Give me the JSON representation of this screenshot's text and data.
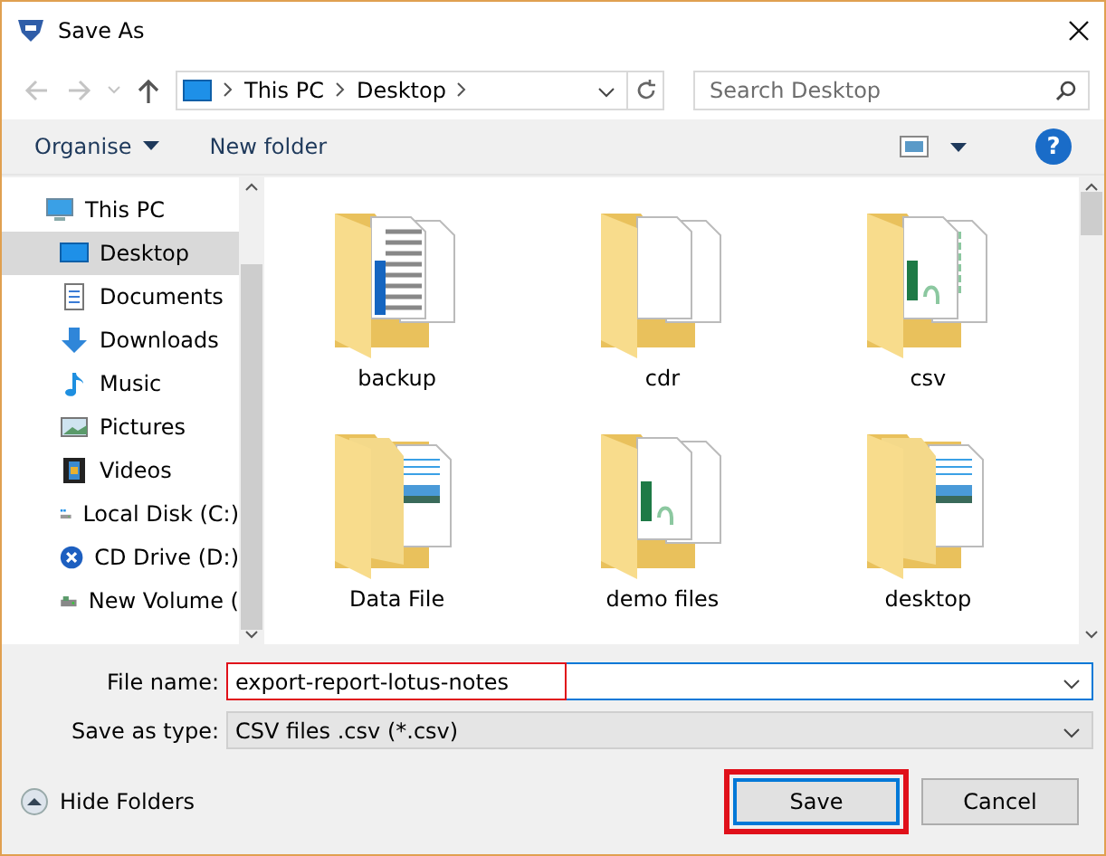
{
  "window": {
    "title": "Save As"
  },
  "address": {
    "path": [
      "This PC",
      "Desktop"
    ],
    "search_placeholder": "Search Desktop"
  },
  "toolbar": {
    "organise": "Organise",
    "new_folder": "New folder",
    "help": "?"
  },
  "sidebar": {
    "items": [
      {
        "label": "This PC",
        "kind": "pc",
        "selected": false
      },
      {
        "label": "Desktop",
        "kind": "desktop",
        "selected": true
      },
      {
        "label": "Documents",
        "kind": "documents",
        "selected": false
      },
      {
        "label": "Downloads",
        "kind": "downloads",
        "selected": false
      },
      {
        "label": "Music",
        "kind": "music",
        "selected": false
      },
      {
        "label": "Pictures",
        "kind": "pictures",
        "selected": false
      },
      {
        "label": "Videos",
        "kind": "videos",
        "selected": false
      },
      {
        "label": "Local Disk (C:)",
        "kind": "disk",
        "selected": false
      },
      {
        "label": "CD Drive (D:)",
        "kind": "cd",
        "selected": false
      },
      {
        "label": "New Volume (",
        "kind": "volume",
        "selected": false
      }
    ]
  },
  "files": [
    {
      "name": "backup",
      "kind": "docs"
    },
    {
      "name": "cdr",
      "kind": "blank"
    },
    {
      "name": "csv",
      "kind": "sheet"
    },
    {
      "name": "Data File",
      "kind": "pictures"
    },
    {
      "name": "demo files",
      "kind": "sheet2"
    },
    {
      "name": "desktop",
      "kind": "pictures"
    }
  ],
  "form": {
    "file_name_label": "File name:",
    "file_name": "export-report-lotus-notes",
    "file_name_highlighted": true,
    "type_label": "Save as type:",
    "type": "CSV files .csv (*.csv)"
  },
  "footer": {
    "hide_folders": "Hide Folders",
    "save": "Save",
    "save_highlighted": true,
    "cancel": "Cancel"
  }
}
